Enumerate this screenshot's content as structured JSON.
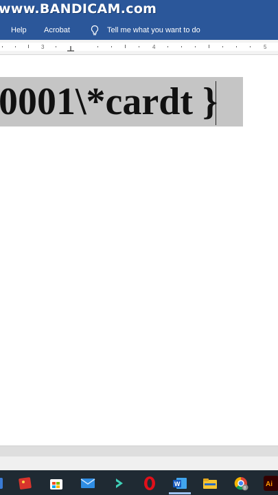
{
  "watermark": "www.BANDICAM.com",
  "ribbon": {
    "tabs": [
      "Help",
      "Acrobat"
    ],
    "tell_me": "Tell me what you want to do"
  },
  "ruler": {
    "numbers": [
      "3",
      "4",
      "5"
    ]
  },
  "document": {
    "field_text": "0001\\*cardt",
    "brace": "}"
  },
  "taskbar": {
    "apps": [
      "paint-icon",
      "store-icon",
      "mail-icon",
      "filmora-icon",
      "opera-icon",
      "word-icon",
      "file-explorer-icon",
      "chrome-icon",
      "illustrator-icon"
    ],
    "illustrator_label": "Ai",
    "word_label": "W",
    "chrome_badge": "B"
  },
  "colors": {
    "word_blue": "#2b579a",
    "field_gray": "#c5c5c5",
    "taskbar": "#1f2a33"
  }
}
